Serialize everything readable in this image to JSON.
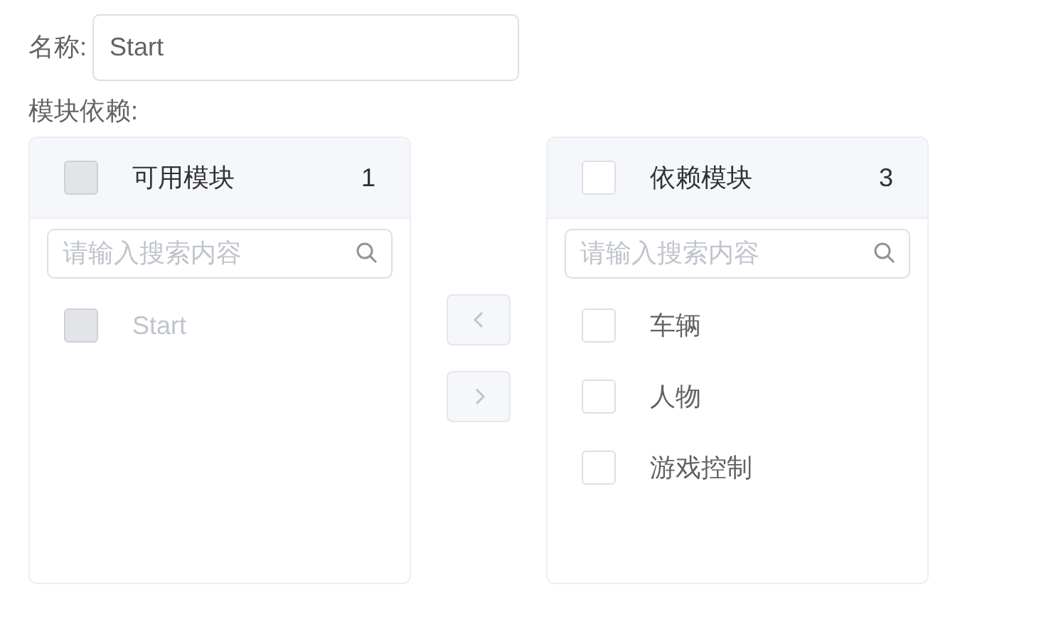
{
  "name_field": {
    "label": "名称:",
    "value": "Start"
  },
  "dependency_label": "模块依赖:",
  "panels": [
    {
      "title": "可用模块",
      "count": "1",
      "header_checked": false,
      "header_disabled": true,
      "search": {
        "placeholder": "请输入搜索内容"
      },
      "items": [
        {
          "label": "Start",
          "checked": false,
          "disabled": true
        }
      ]
    },
    {
      "title": "依赖模块",
      "count": "3",
      "header_checked": false,
      "header_disabled": false,
      "search": {
        "placeholder": "请输入搜索内容"
      },
      "items": [
        {
          "label": "车辆",
          "checked": false,
          "disabled": false
        },
        {
          "label": "人物",
          "checked": false,
          "disabled": false
        },
        {
          "label": "游戏控制",
          "checked": false,
          "disabled": false
        }
      ]
    }
  ],
  "transfer_buttons": [
    {
      "kind": "left",
      "disabled": true
    },
    {
      "kind": "right",
      "disabled": true
    }
  ]
}
